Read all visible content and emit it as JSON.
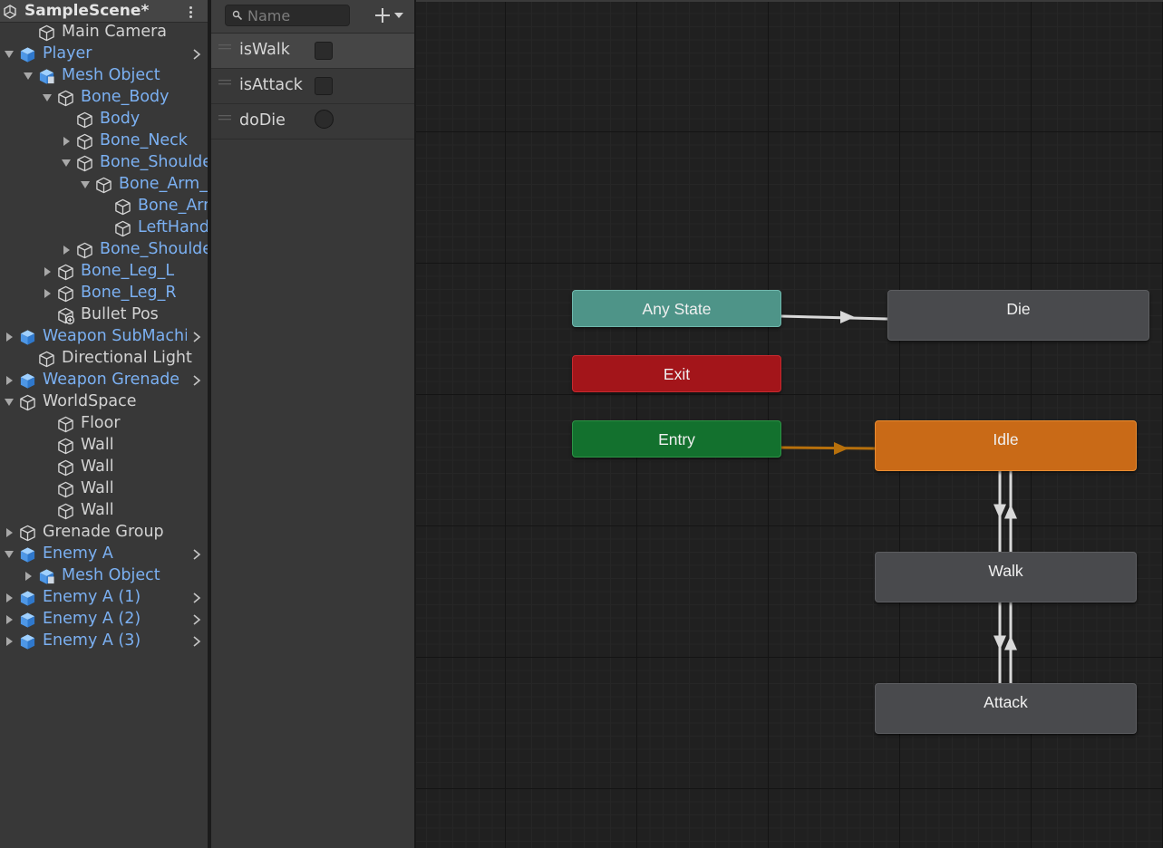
{
  "hierarchy": {
    "scene_title": "SampleScene*",
    "rows": [
      {
        "label": "Main Camera",
        "depth": 1,
        "arrow": "none",
        "icon": "gameobject",
        "prefab": false,
        "chevron": false
      },
      {
        "label": "Player",
        "depth": 0,
        "arrow": "expanded",
        "icon": "prefab",
        "prefab": true,
        "chevron": true
      },
      {
        "label": "Mesh Object",
        "depth": 1,
        "arrow": "expanded",
        "icon": "prefab-model",
        "prefab": true,
        "chevron": false
      },
      {
        "label": "Bone_Body",
        "depth": 2,
        "arrow": "expanded",
        "icon": "gameobject",
        "prefab": true,
        "chevron": false
      },
      {
        "label": "Body",
        "depth": 3,
        "arrow": "none",
        "icon": "gameobject",
        "prefab": true,
        "chevron": false
      },
      {
        "label": "Bone_Neck",
        "depth": 3,
        "arrow": "collapsed",
        "icon": "gameobject",
        "prefab": true,
        "chevron": false
      },
      {
        "label": "Bone_Shoulder_L",
        "depth": 3,
        "arrow": "expanded",
        "icon": "gameobject",
        "prefab": true,
        "chevron": false
      },
      {
        "label": "Bone_Arm_L",
        "depth": 4,
        "arrow": "expanded",
        "icon": "gameobject",
        "prefab": true,
        "chevron": false
      },
      {
        "label": "Bone_Arm_L",
        "depth": 5,
        "arrow": "none",
        "icon": "gameobject",
        "prefab": true,
        "chevron": false
      },
      {
        "label": "LeftHand",
        "depth": 5,
        "arrow": "none",
        "icon": "gameobject",
        "prefab": true,
        "chevron": false
      },
      {
        "label": "Bone_Shoulder_R",
        "depth": 3,
        "arrow": "collapsed",
        "icon": "gameobject",
        "prefab": true,
        "chevron": false
      },
      {
        "label": "Bone_Leg_L",
        "depth": 2,
        "arrow": "collapsed",
        "icon": "gameobject",
        "prefab": true,
        "chevron": false
      },
      {
        "label": "Bone_Leg_R",
        "depth": 2,
        "arrow": "collapsed",
        "icon": "gameobject",
        "prefab": true,
        "chevron": false
      },
      {
        "label": "Bullet Pos",
        "depth": 2,
        "arrow": "none",
        "icon": "gameobject-added",
        "prefab": false,
        "chevron": false
      },
      {
        "label": "Weapon SubMachineGun",
        "depth": 0,
        "arrow": "collapsed",
        "icon": "prefab",
        "prefab": true,
        "chevron": true
      },
      {
        "label": "Directional Light",
        "depth": 1,
        "arrow": "none",
        "icon": "gameobject",
        "prefab": false,
        "chevron": false
      },
      {
        "label": "Weapon Grenade",
        "depth": 0,
        "arrow": "collapsed",
        "icon": "prefab",
        "prefab": true,
        "chevron": true
      },
      {
        "label": "WorldSpace",
        "depth": 0,
        "arrow": "expanded",
        "icon": "gameobject",
        "prefab": false,
        "chevron": false
      },
      {
        "label": "Floor",
        "depth": 2,
        "arrow": "none",
        "icon": "gameobject",
        "prefab": false,
        "chevron": false
      },
      {
        "label": "Wall",
        "depth": 2,
        "arrow": "none",
        "icon": "gameobject",
        "prefab": false,
        "chevron": false
      },
      {
        "label": "Wall",
        "depth": 2,
        "arrow": "none",
        "icon": "gameobject",
        "prefab": false,
        "chevron": false
      },
      {
        "label": "Wall",
        "depth": 2,
        "arrow": "none",
        "icon": "gameobject",
        "prefab": false,
        "chevron": false
      },
      {
        "label": "Wall",
        "depth": 2,
        "arrow": "none",
        "icon": "gameobject",
        "prefab": false,
        "chevron": false
      },
      {
        "label": "Grenade Group",
        "depth": 0,
        "arrow": "collapsed",
        "icon": "gameobject",
        "prefab": false,
        "chevron": false
      },
      {
        "label": "Enemy A",
        "depth": 0,
        "arrow": "expanded",
        "icon": "prefab",
        "prefab": true,
        "chevron": true
      },
      {
        "label": "Mesh Object",
        "depth": 1,
        "arrow": "collapsed",
        "icon": "prefab-model",
        "prefab": true,
        "chevron": false
      },
      {
        "label": "Enemy A (1)",
        "depth": 0,
        "arrow": "collapsed",
        "icon": "prefab",
        "prefab": true,
        "chevron": true
      },
      {
        "label": "Enemy A (2)",
        "depth": 0,
        "arrow": "collapsed",
        "icon": "prefab",
        "prefab": true,
        "chevron": true
      },
      {
        "label": "Enemy A (3)",
        "depth": 0,
        "arrow": "collapsed",
        "icon": "prefab",
        "prefab": true,
        "chevron": true
      }
    ]
  },
  "parameters": {
    "search": {
      "placeholder": "Name",
      "value": ""
    },
    "add_icon": "plus-icon",
    "items": [
      {
        "name": "isWalk",
        "type": "bool",
        "value": false
      },
      {
        "name": "isAttack",
        "type": "bool",
        "value": false
      },
      {
        "name": "doDie",
        "type": "trigger",
        "value": false
      }
    ]
  },
  "graph": {
    "states": [
      {
        "id": "any",
        "label": "Any State",
        "color": "#4e9488",
        "border": "#6fb8ad"
      },
      {
        "id": "die",
        "label": "Die",
        "color": "#494a4d",
        "border": "#5c5d60"
      },
      {
        "id": "exit",
        "label": "Exit",
        "color": "#a3151a",
        "border": "#c62a2f"
      },
      {
        "id": "entry",
        "label": "Entry",
        "color": "#13712e",
        "border": "#2d9446"
      },
      {
        "id": "idle",
        "label": "Idle",
        "color": "#c96a17",
        "border": "#ea8d32"
      },
      {
        "id": "walk",
        "label": "Walk",
        "color": "#494a4d",
        "border": "#5c5d60"
      },
      {
        "id": "attack",
        "label": "Attack",
        "color": "#494a4d",
        "border": "#5c5d60"
      }
    ],
    "transitions": [
      {
        "from": "any",
        "to": "die"
      },
      {
        "from": "entry",
        "to": "idle"
      },
      {
        "from": "idle",
        "to": "walk"
      },
      {
        "from": "walk",
        "to": "idle"
      },
      {
        "from": "walk",
        "to": "attack"
      },
      {
        "from": "attack",
        "to": "walk"
      }
    ],
    "colors": {
      "transition": "#d9d9d9",
      "entry_transition": "#b7700c"
    }
  }
}
